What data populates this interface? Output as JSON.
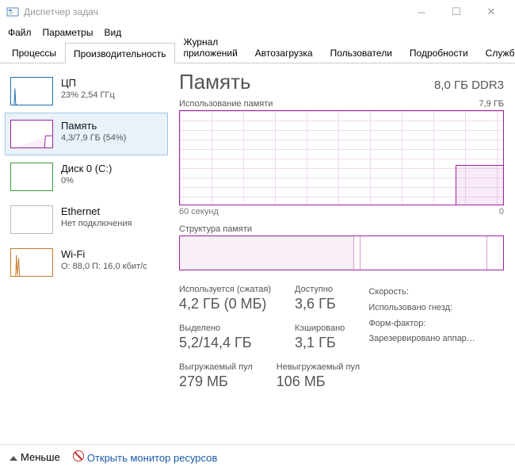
{
  "window": {
    "title": "Диспетчер задач"
  },
  "menu": {
    "file": "Файл",
    "options": "Параметры",
    "view": "Вид"
  },
  "tabs": {
    "processes": "Процессы",
    "performance": "Производительность",
    "apphistory": "Журнал приложений",
    "startup": "Автозагрузка",
    "users": "Пользователи",
    "details": "Подробности",
    "services": "Службы"
  },
  "sidebar": {
    "cpu": {
      "title": "ЦП",
      "sub": "23% 2,54 ГГц"
    },
    "mem": {
      "title": "Память",
      "sub": "4,3/7,9 ГБ (54%)"
    },
    "disk": {
      "title": "Диск 0 (C:)",
      "sub": "0%"
    },
    "eth": {
      "title": "Ethernet",
      "sub": "Нет подключения"
    },
    "wifi": {
      "title": "Wi-Fi",
      "sub": "О: 88,0 П: 16,0 кбит/с"
    }
  },
  "main": {
    "title": "Память",
    "subtitle": "8,0 ГБ DDR3",
    "usage_label": "Использование памяти",
    "usage_max": "7,9 ГБ",
    "axis_left": "60 секунд",
    "axis_right": "0",
    "comp_label": "Структура памяти",
    "stats": {
      "inuse_l": "Используется (сжатая)",
      "inuse_v": "4,2 ГБ (0 МБ)",
      "avail_l": "Доступно",
      "avail_v": "3,6 ГБ",
      "commit_l": "Выделено",
      "commit_v": "5,2/14,4 ГБ",
      "cached_l": "Кэшировано",
      "cached_v": "3,1 ГБ",
      "paged_l": "Выгружаемый пул",
      "paged_v": "279 МБ",
      "nonpaged_l": "Невыгружаемый пул",
      "nonpaged_v": "106 МБ"
    },
    "props": {
      "speed": "Скорость:",
      "slots": "Использовано гнезд:",
      "form": "Форм-фактор:",
      "reserved": "Зарезервировано аппар…"
    }
  },
  "status": {
    "less": "Меньше",
    "monitor": "Открыть монитор ресурсов"
  },
  "chart_data": {
    "type": "line",
    "title": "Использование памяти",
    "xlabel": "секунд",
    "ylabel": "ГБ",
    "x": [
      60,
      55,
      50,
      45,
      40,
      35,
      30,
      25,
      20,
      15,
      12,
      10,
      8,
      6,
      4,
      2,
      0
    ],
    "values": [
      0,
      0,
      0,
      0,
      0,
      0,
      0,
      0,
      0,
      0,
      0,
      3.2,
      3.3,
      3.3,
      3.3,
      3.4,
      3.4
    ],
    "ylim": [
      0,
      7.9
    ],
    "xlim": [
      60,
      0
    ]
  }
}
